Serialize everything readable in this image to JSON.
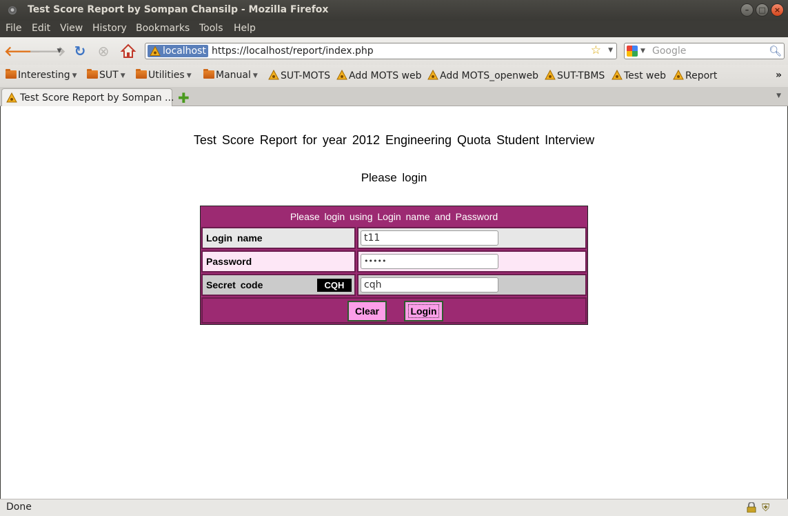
{
  "window": {
    "title": "Test Score Report by Sompan Chansilp - Mozilla Firefox"
  },
  "menu": [
    "File",
    "Edit",
    "View",
    "History",
    "Bookmarks",
    "Tools",
    "Help"
  ],
  "urlbar": {
    "site": "localhost",
    "url": "https://localhost/report/index.php"
  },
  "search": {
    "placeholder": "Google"
  },
  "bookmarks": [
    "Interesting",
    "SUT",
    "Utilities",
    "Manual",
    "SUT-MOTS",
    "Add MOTS web",
    "Add MOTS_openweb",
    "SUT-TBMS",
    "Test web",
    "Report"
  ],
  "tab": {
    "label": "Test Score Report by Sompan ..."
  },
  "page": {
    "heading": "Test Score Report for year 2012 Engineering Quota Student Interview",
    "subheading": "Please login",
    "form": {
      "header": "Please login using Login name and Password",
      "login_label": "Login name",
      "login_value": "t11",
      "password_label": "Password",
      "password_value": "•••••",
      "secret_label": "Secret code",
      "captcha": "CQH",
      "secret_value": "cqh",
      "clear_label": "Clear",
      "login_button": "Login"
    }
  },
  "status": {
    "text": "Done"
  },
  "colors": {
    "form_accent": "#9c2a72",
    "button_pink": "#fb9ee8"
  }
}
